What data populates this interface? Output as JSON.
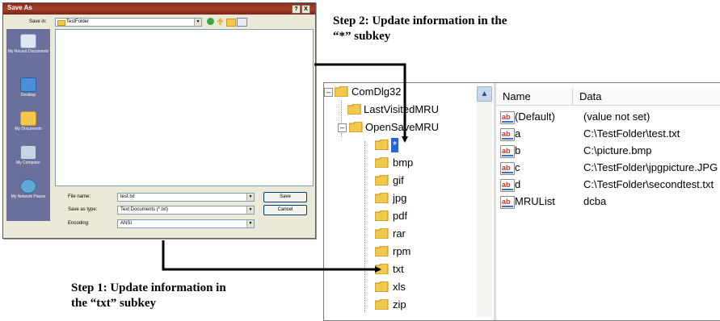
{
  "dialog": {
    "title": "Save As",
    "title_buttons": [
      "?",
      "X"
    ],
    "save_in_label": "Save in:",
    "save_in_value": "TestFolder",
    "places": [
      {
        "label": "My Recent Documents",
        "icon": "recent-documents-icon"
      },
      {
        "label": "Desktop",
        "icon": "desktop-icon"
      },
      {
        "label": "My Documents",
        "icon": "my-documents-icon"
      },
      {
        "label": "My Computer",
        "icon": "my-computer-icon"
      },
      {
        "label": "My Network Places",
        "icon": "network-places-icon"
      }
    ],
    "file_name_label": "File name:",
    "file_name_value": "test.txt",
    "save_as_type_label": "Save as type:",
    "save_as_type_value": "Text Documents (*.txt)",
    "encoding_label": "Encoding:",
    "encoding_value": "ANSI",
    "save_button": "Save",
    "cancel_button": "Cancel"
  },
  "captions": {
    "step1_line1": "Step 1: Update information in",
    "step1_line2": "the “txt” subkey",
    "step2_line1": "Step 2: Update information in the",
    "step2_line2": "“*” subkey"
  },
  "registry": {
    "tree": {
      "root": "ComDlg32",
      "last_visited": "LastVisitedMRU",
      "open_save": "OpenSaveMRU",
      "children": [
        "*",
        "bmp",
        "gif",
        "jpg",
        "pdf",
        "rar",
        "rpm",
        "txt",
        "xls",
        "zip"
      ],
      "selected": "*"
    },
    "columns": {
      "name": "Name",
      "data": "Data"
    },
    "values": [
      {
        "name": "(Default)",
        "data": "(value not set)"
      },
      {
        "name": "a",
        "data": "C:\\TestFolder\\test.txt"
      },
      {
        "name": "b",
        "data": "C:\\picture.bmp"
      },
      {
        "name": "c",
        "data": "C:\\TestFolder\\jpgpicture.JPG"
      },
      {
        "name": "d",
        "data": "C:\\TestFolder\\secondtest.txt"
      },
      {
        "name": "MRUList",
        "data": "dcba"
      }
    ],
    "value_icon_text": "ab"
  },
  "colors": {
    "title_bar": "#8a2c1c",
    "places_bar": "#6b6f9c",
    "folder": "#f2c94c",
    "selection": "#2a63d6"
  }
}
